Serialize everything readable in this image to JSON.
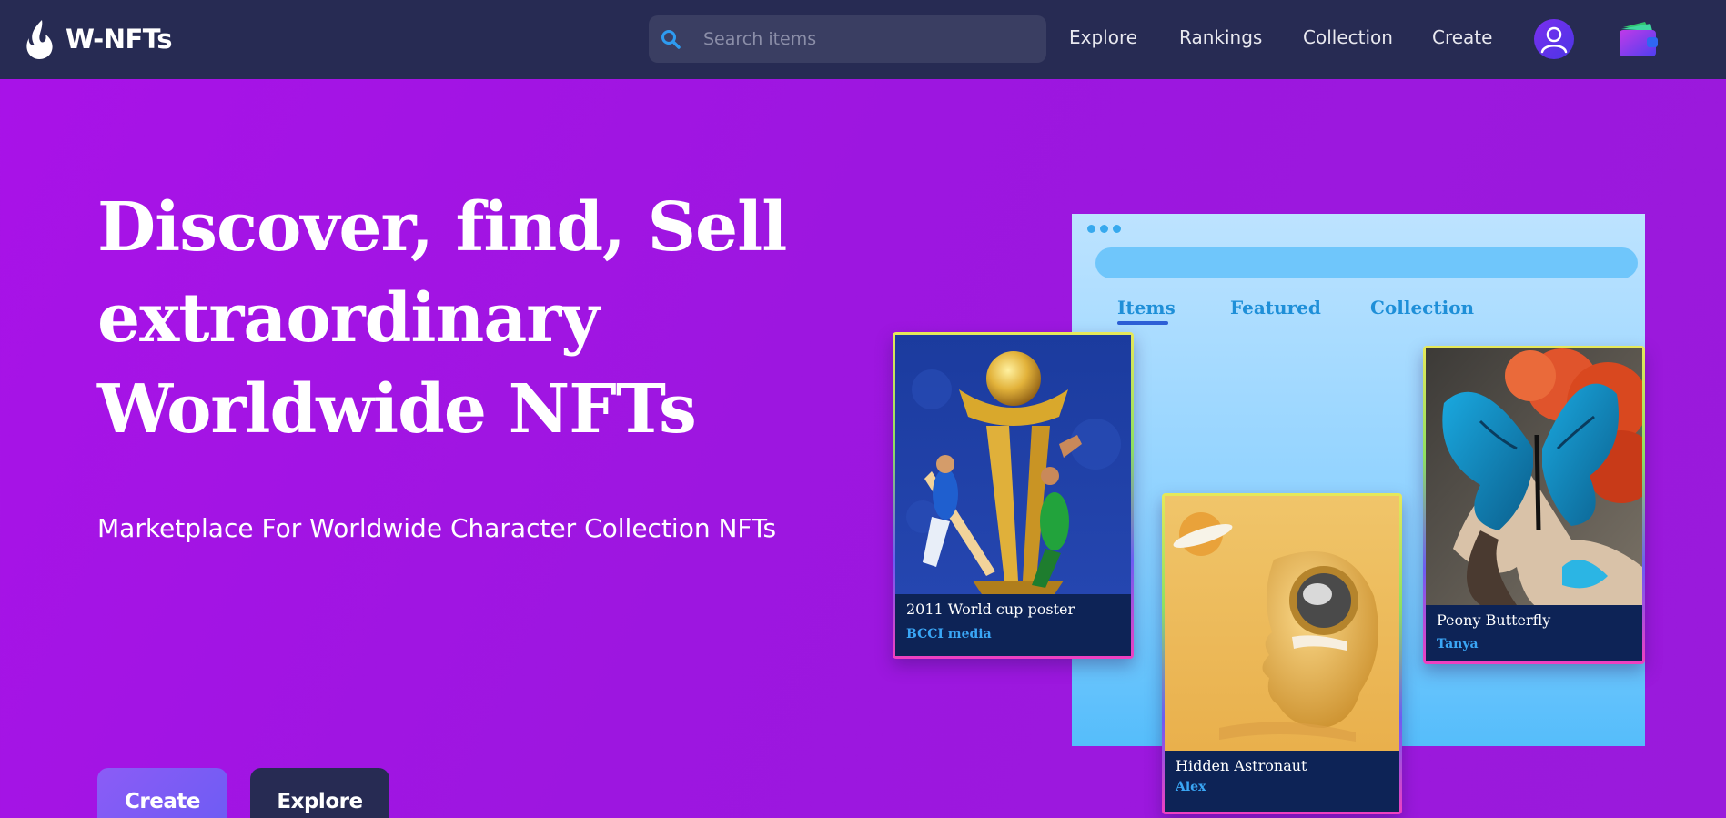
{
  "navbar": {
    "brand": "W-NFTs",
    "search_placeholder": "Search items",
    "links": [
      "Explore",
      "Rankings",
      "Collection",
      "Create"
    ]
  },
  "hero": {
    "title_lines": [
      "Discover, find, Sell",
      "extraordinary",
      "Worldwide NFTs"
    ],
    "subtitle": "Marketplace For Worldwide Character Collection NFTs",
    "buttons": {
      "create": "Create",
      "explore": "Explore"
    }
  },
  "showcase": {
    "tabs": [
      "Items",
      "Featured",
      "Collection"
    ],
    "active_tab": "Items",
    "cards": [
      {
        "title": "2011 World cup poster",
        "author": "BCCI media"
      },
      {
        "title": "Hidden Astronaut",
        "author": "Alex"
      },
      {
        "title": "Peony Butterfly",
        "author": "Tanya"
      }
    ]
  },
  "colors": {
    "navbar": "#272b53",
    "hero_background": "#a116e3",
    "accent_blue": "#3aa6f5",
    "create_button": "#8b5cf6"
  },
  "icons": [
    "flame-logo-icon",
    "search-icon",
    "user-avatar-icon",
    "wallet-icon"
  ]
}
